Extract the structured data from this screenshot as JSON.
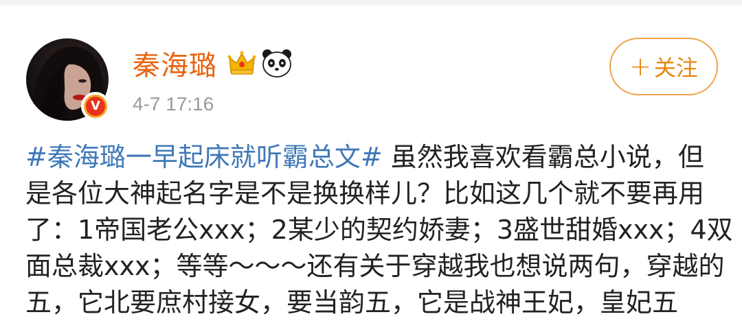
{
  "post": {
    "username": "秦海璐",
    "timestamp": "4-7 17:16",
    "follow_button": {
      "plus": "+",
      "label": "关注"
    },
    "verified_badge": "V",
    "icons": {
      "avatar": "profile-photo",
      "verified": "verified-v-badge",
      "crown": "crown-emoji",
      "panda": "panda-emoji",
      "plus": "plus-icon"
    },
    "colors": {
      "username": "#e8620e",
      "hashtag": "#3f78b8",
      "follow_border": "#f0a24b",
      "timestamp": "#9a9a9a"
    },
    "body": {
      "hashtag": "#秦海璐一早起床就听霸总文#",
      "line1_rest": " 虽然我喜欢看霸总小说，但",
      "line2": "是各位大神起名字是不是换换样儿？比如这几个就不要再用",
      "line3": "了：1帝国老公xxx；2某少的契约娇妻；3盛世甜婚xxx；4双",
      "line4": "面总裁xxx；等等～～～还有关于穿越我也想说两句，穿越的",
      "line5": "五，它北要庶村接女，要当韵五，它是战神王妃，皇妃五"
    }
  }
}
